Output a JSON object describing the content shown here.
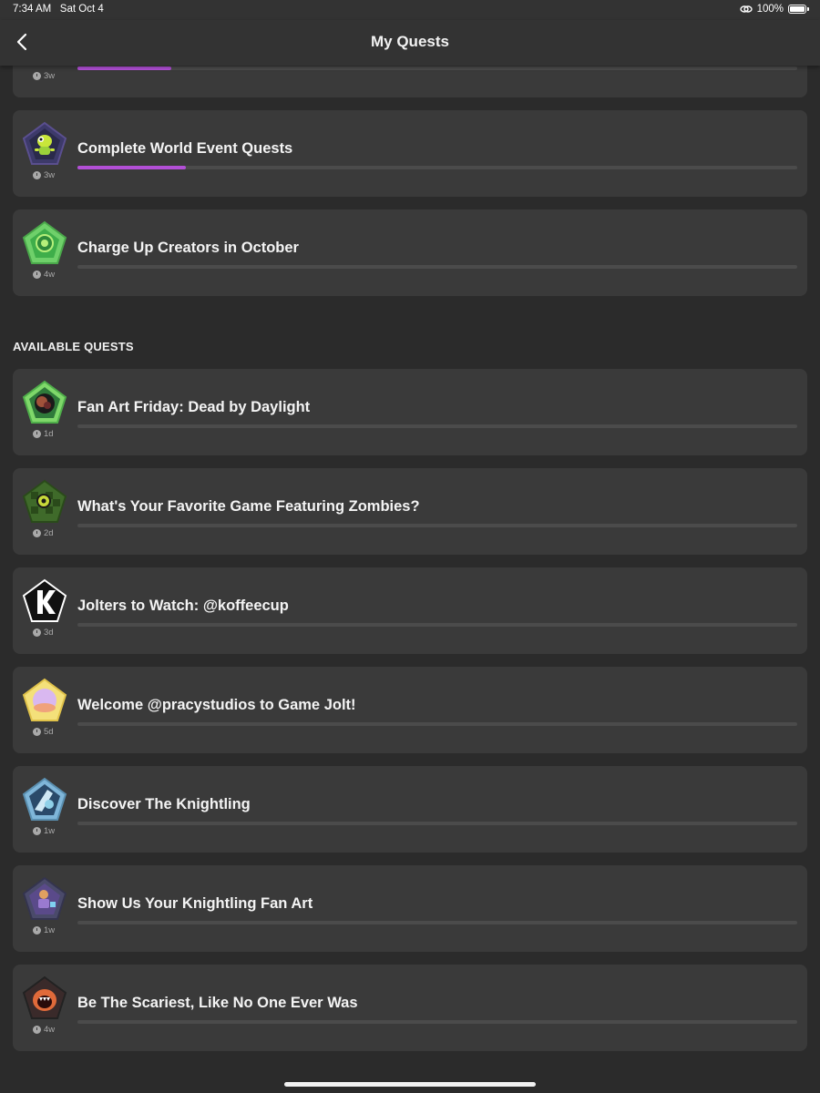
{
  "status_bar": {
    "time": "7:34 AM",
    "date": "Sat Oct 4",
    "battery": "100%"
  },
  "nav": {
    "title": "My Quests",
    "back_icon": "chevron-left-icon"
  },
  "active_quests": [
    {
      "title": "",
      "time": "3w",
      "progress": 0.13,
      "badge_icon": "quest-badge-icon"
    },
    {
      "title": "Complete World Event Quests",
      "time": "3w",
      "progress": 0.15,
      "badge_icon": "frog-badge-icon"
    },
    {
      "title": "Charge Up Creators in October",
      "time": "4w",
      "progress": 0,
      "badge_icon": "charge-badge-icon"
    }
  ],
  "available_label": "AVAILABLE QUESTS",
  "available_quests": [
    {
      "title": "Fan Art Friday: Dead by Daylight",
      "time": "1d",
      "progress": 0,
      "badge_icon": "dead-by-daylight-badge-icon"
    },
    {
      "title": "What's Your Favorite Game Featuring Zombies?",
      "time": "2d",
      "progress": 0,
      "badge_icon": "zombie-badge-icon"
    },
    {
      "title": "Jolters to Watch: @koffeecup",
      "time": "3d",
      "progress": 0,
      "badge_icon": "koffeecup-badge-icon"
    },
    {
      "title": "Welcome @pracystudios to Game Jolt!",
      "time": "5d",
      "progress": 0,
      "badge_icon": "welcome-badge-icon"
    },
    {
      "title": "Discover The Knightling",
      "time": "1w",
      "progress": 0,
      "badge_icon": "knightling-badge-icon"
    },
    {
      "title": "Show Us Your Knightling Fan Art",
      "time": "1w",
      "progress": 0,
      "badge_icon": "knightling-fan-art-badge-icon"
    },
    {
      "title": "Be The Scariest, Like No One Ever Was",
      "time": "4w",
      "progress": 0,
      "badge_icon": "scariest-badge-icon"
    }
  ],
  "colors": {
    "background": "#2b2b2b",
    "card": "#3a3a3a",
    "progress_fill": "#b24fd6",
    "track": "#4b4b4b"
  }
}
